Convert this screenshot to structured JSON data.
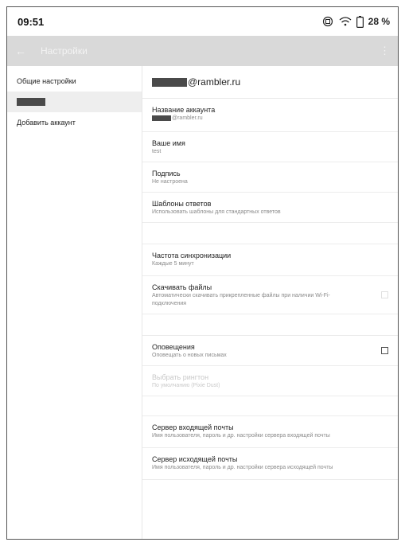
{
  "status": {
    "time": "09:51",
    "battery": "28 %"
  },
  "appbar": {
    "back_icon": "←",
    "title": "Настройки",
    "more_icon": "⋮"
  },
  "left": {
    "general": "Общие настройки",
    "account_suffix": "",
    "add_account": "Добавить аккаунт"
  },
  "header": {
    "email_domain": "@rambler.ru"
  },
  "items": [
    {
      "title": "Название аккаунта",
      "subtitle": "@rambler.ru"
    },
    {
      "title": "Ваше имя",
      "subtitle": "test"
    },
    {
      "title": "Подпись",
      "subtitle": "Не настроена"
    },
    {
      "title": "Шаблоны ответов",
      "subtitle": "Использовать шаблоны для стандартных ответов"
    },
    {
      "title": "Частота синхронизации",
      "subtitle": "Каждые 5 минут"
    },
    {
      "title": "Скачивать файлы",
      "subtitle": "Автоматически скачивать прикрепленные файлы при наличии Wi-Fi-подключения"
    },
    {
      "title": "Оповещения",
      "subtitle": "Оповещать о новых письмах"
    },
    {
      "title": "Выбрать рингтон",
      "subtitle": "По умолчанию (Pixie Dust)"
    },
    {
      "title": "Сервер входящей почты",
      "subtitle": "Имя пользователя, пароль и др. настройки сервера входящей почты"
    },
    {
      "title": "Сервер исходящей почты",
      "subtitle": "Имя пользователя, пароль и др. настройки сервера исходящей почты"
    }
  ]
}
